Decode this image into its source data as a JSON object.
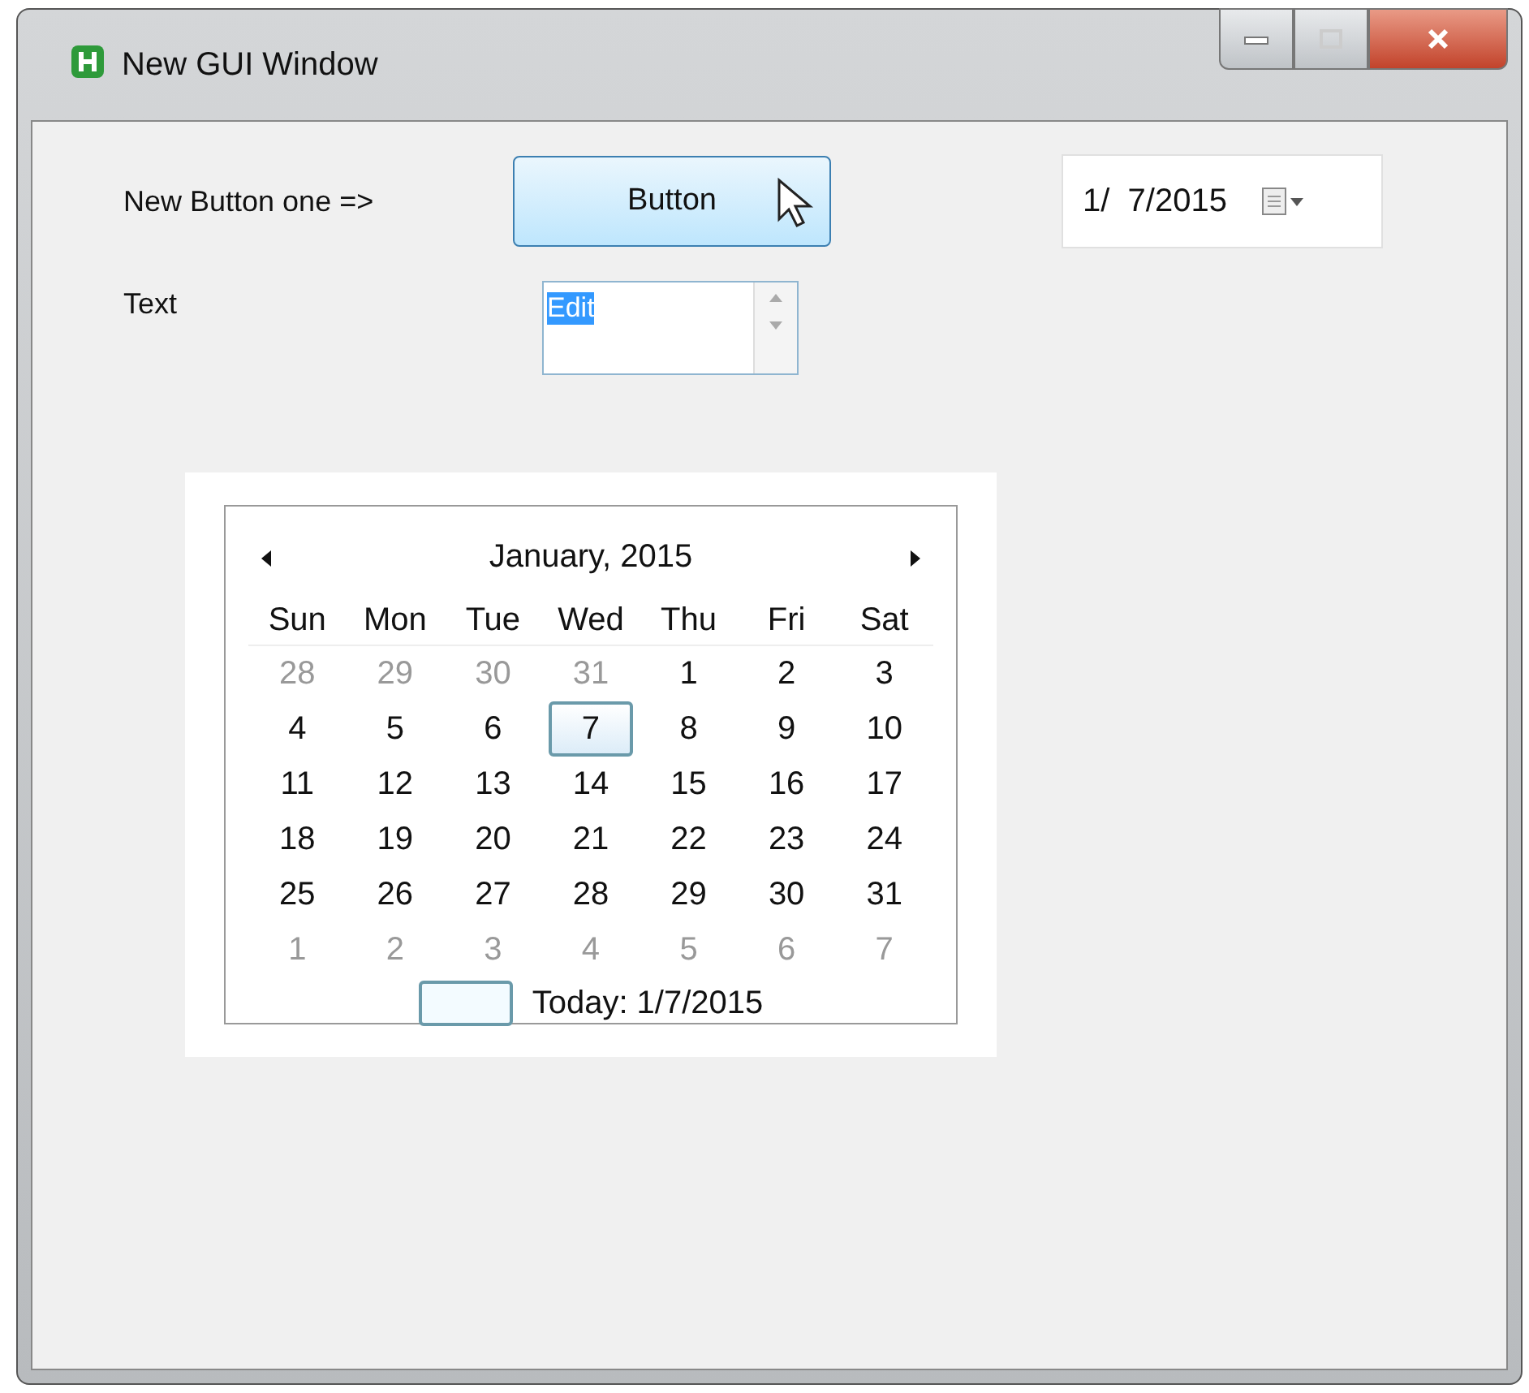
{
  "window": {
    "title": "New GUI Window"
  },
  "label_one": "New Button one =>",
  "button": {
    "label": "Button",
    "hovered": true
  },
  "date_picker": {
    "value": "1/  7/2015"
  },
  "label_two": "Text",
  "edit": {
    "value": "Edit",
    "selected": true
  },
  "calendar": {
    "title": "January, 2015",
    "weekdays": [
      "Sun",
      "Mon",
      "Tue",
      "Wed",
      "Thu",
      "Fri",
      "Sat"
    ],
    "weeks": [
      [
        {
          "label": "28",
          "other_month": true,
          "selected": false
        },
        {
          "label": "29",
          "other_month": true,
          "selected": false
        },
        {
          "label": "30",
          "other_month": true,
          "selected": false
        },
        {
          "label": "31",
          "other_month": true,
          "selected": false
        },
        {
          "label": "1",
          "other_month": false,
          "selected": false
        },
        {
          "label": "2",
          "other_month": false,
          "selected": false
        },
        {
          "label": "3",
          "other_month": false,
          "selected": false
        }
      ],
      [
        {
          "label": "4",
          "other_month": false,
          "selected": false
        },
        {
          "label": "5",
          "other_month": false,
          "selected": false
        },
        {
          "label": "6",
          "other_month": false,
          "selected": false
        },
        {
          "label": "7",
          "other_month": false,
          "selected": true
        },
        {
          "label": "8",
          "other_month": false,
          "selected": false
        },
        {
          "label": "9",
          "other_month": false,
          "selected": false
        },
        {
          "label": "10",
          "other_month": false,
          "selected": false
        }
      ],
      [
        {
          "label": "11",
          "other_month": false,
          "selected": false
        },
        {
          "label": "12",
          "other_month": false,
          "selected": false
        },
        {
          "label": "13",
          "other_month": false,
          "selected": false
        },
        {
          "label": "14",
          "other_month": false,
          "selected": false
        },
        {
          "label": "15",
          "other_month": false,
          "selected": false
        },
        {
          "label": "16",
          "other_month": false,
          "selected": false
        },
        {
          "label": "17",
          "other_month": false,
          "selected": false
        }
      ],
      [
        {
          "label": "18",
          "other_month": false,
          "selected": false
        },
        {
          "label": "19",
          "other_month": false,
          "selected": false
        },
        {
          "label": "20",
          "other_month": false,
          "selected": false
        },
        {
          "label": "21",
          "other_month": false,
          "selected": false
        },
        {
          "label": "22",
          "other_month": false,
          "selected": false
        },
        {
          "label": "23",
          "other_month": false,
          "selected": false
        },
        {
          "label": "24",
          "other_month": false,
          "selected": false
        }
      ],
      [
        {
          "label": "25",
          "other_month": false,
          "selected": false
        },
        {
          "label": "26",
          "other_month": false,
          "selected": false
        },
        {
          "label": "27",
          "other_month": false,
          "selected": false
        },
        {
          "label": "28",
          "other_month": false,
          "selected": false
        },
        {
          "label": "29",
          "other_month": false,
          "selected": false
        },
        {
          "label": "30",
          "other_month": false,
          "selected": false
        },
        {
          "label": "31",
          "other_month": false,
          "selected": false
        }
      ],
      [
        {
          "label": "1",
          "other_month": true,
          "selected": false
        },
        {
          "label": "2",
          "other_month": true,
          "selected": false
        },
        {
          "label": "3",
          "other_month": true,
          "selected": false
        },
        {
          "label": "4",
          "other_month": true,
          "selected": false
        },
        {
          "label": "5",
          "other_month": true,
          "selected": false
        },
        {
          "label": "6",
          "other_month": true,
          "selected": false
        },
        {
          "label": "7",
          "other_month": true,
          "selected": false
        }
      ]
    ],
    "today": "Today: 1/7/2015"
  }
}
